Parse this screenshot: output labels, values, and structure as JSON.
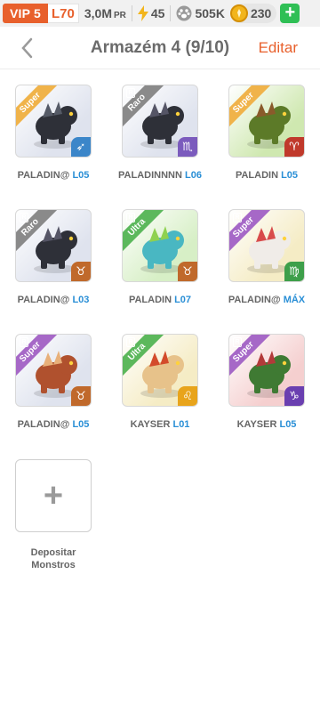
{
  "status": {
    "vip": "VIP 5",
    "level": "L70",
    "pr_value": "3,0M",
    "pr_unit": "PR",
    "energy": "45",
    "food": "505K",
    "gold": "230",
    "plus": "+"
  },
  "header": {
    "title": "Armazém 4 (9/10)",
    "edit": "Editar"
  },
  "monsters": [
    {
      "name": "PALADIN@",
      "level": "L05",
      "rarity": "Super",
      "ribbon_color": "#f0b34a",
      "bg": "#dfe3ee",
      "elem_color": "#3b86c9",
      "elem_icon": "➶",
      "body": "#2e3038",
      "accent": "#555a66",
      "r": false
    },
    {
      "name": "PALADINNNN",
      "level": "L06",
      "rarity": "Raro",
      "ribbon_color": "#8a8a8a",
      "bg": "#dfe3ee",
      "elem_color": "#7b5bbd",
      "elem_icon": "♏",
      "body": "#2e3038",
      "accent": "#556",
      "r": true
    },
    {
      "name": "PALADIN",
      "level": "L05",
      "rarity": "Super",
      "ribbon_color": "#f0b34a",
      "bg": "#cfe8b0",
      "elem_color": "#c0392b",
      "elem_icon": "♈",
      "body": "#5c7a28",
      "accent": "#8a5a2b",
      "r": false
    },
    {
      "name": "PALADIN@",
      "level": "L03",
      "rarity": "Raro",
      "ribbon_color": "#8a8a8a",
      "bg": "#dfe3ee",
      "elem_color": "#c0692b",
      "elem_icon": "♉",
      "body": "#2e3038",
      "accent": "#556",
      "r": true
    },
    {
      "name": "PALADIN",
      "level": "L07",
      "rarity": "Ultra",
      "ribbon_color": "#5cb85c",
      "bg": "#d7efc6",
      "elem_color": "#c0692b",
      "elem_icon": "♉",
      "body": "#49b7c2",
      "accent": "#8fd14f",
      "r": true
    },
    {
      "name": "PALADIN@",
      "level": "MÁX",
      "rarity": "Super",
      "ribbon_color": "#a668c7",
      "bg": "#f5ecc5",
      "elem_color": "#3d9f4a",
      "elem_icon": "♍",
      "body": "#f0ece8",
      "accent": "#d84b4b",
      "r": true
    },
    {
      "name": "PALADIN@",
      "level": "L05",
      "rarity": "Super",
      "ribbon_color": "#a668c7",
      "bg": "#dfe3ee",
      "elem_color": "#c0692b",
      "elem_icon": "♉",
      "body": "#b0512e",
      "accent": "#e8b07a",
      "r": true
    },
    {
      "name": "KAYSER",
      "level": "L01",
      "rarity": "Ultra",
      "ribbon_color": "#5cb85c",
      "bg": "#f5ecc5",
      "elem_color": "#e8a41c",
      "elem_icon": "♌",
      "body": "#e7c28a",
      "accent": "#d34b2b",
      "r": true
    },
    {
      "name": "KAYSER",
      "level": "L05",
      "rarity": "Super",
      "ribbon_color": "#a668c7",
      "bg": "#f5cfcf",
      "elem_color": "#6a3fb0",
      "elem_icon": "♑",
      "body": "#3f7a33",
      "accent": "#b33a3a",
      "r": true
    }
  ],
  "deposit": {
    "icon": "+",
    "label_line1": "Depositar",
    "label_line2": "Monstros"
  }
}
